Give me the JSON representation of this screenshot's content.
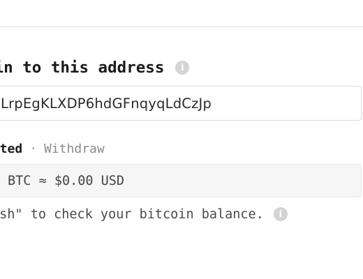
{
  "heading": {
    "text": "oin to this address",
    "info_icon": "info-icon"
  },
  "address": {
    "value": "LrpEgKLXDP6hdGFnqyqLdCzJp"
  },
  "tabs": {
    "active_label": "sited",
    "separator": "·",
    "inactive_label": "Withdraw"
  },
  "balance": {
    "text": "BTC ≈ $0.00 USD"
  },
  "hint": {
    "text": "esh\" to check your bitcoin balance.",
    "info_icon": "info-icon"
  }
}
